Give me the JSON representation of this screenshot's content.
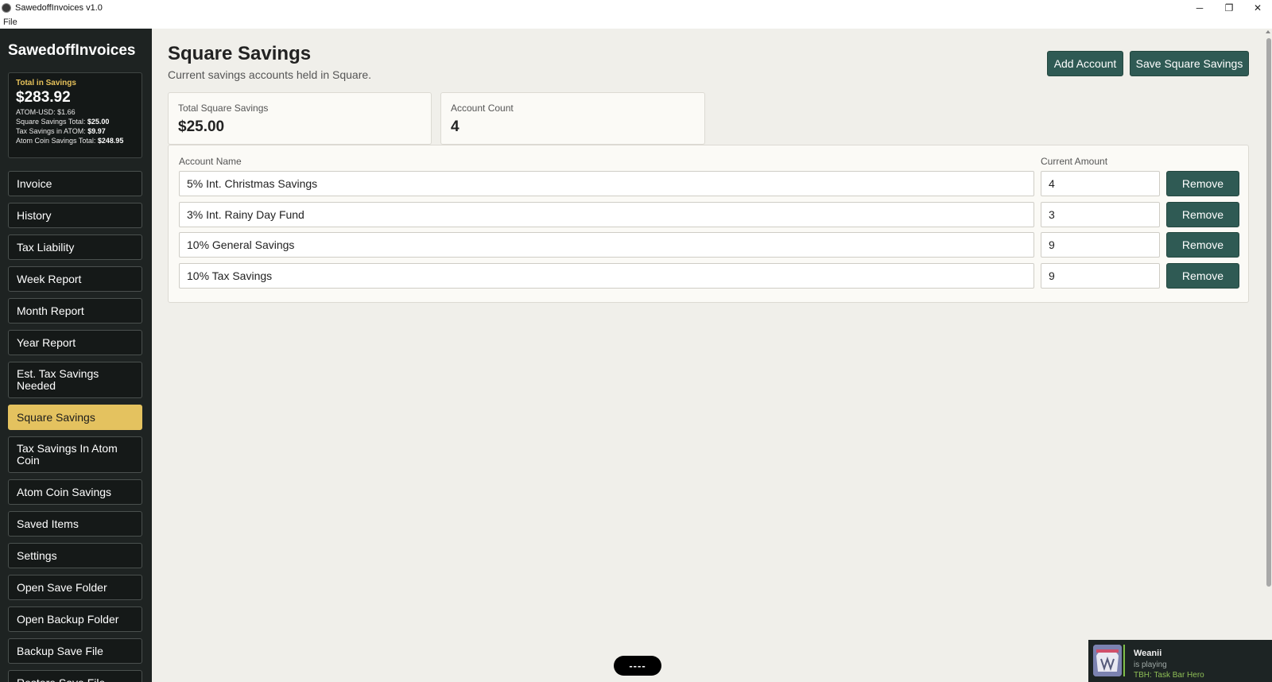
{
  "window": {
    "title": "SawedoffInvoices v1.0",
    "menu": [
      "File"
    ],
    "controls": {
      "minimize": "─",
      "maximize": "❐",
      "close": "✕"
    }
  },
  "sidebar": {
    "brand": "SawedoffInvoices",
    "summary": {
      "label": "Total in Savings",
      "total": "$283.92",
      "atom_price": "ATOM-USD: $1.66",
      "square_label": "Square Savings Total:",
      "square_value": "$25.00",
      "tax_label": "Tax Savings in ATOM:",
      "tax_value": "$9.97",
      "atom_label": "Atom Coin Savings Total:",
      "atom_value": "$248.95"
    },
    "items": [
      {
        "label": "Invoice"
      },
      {
        "label": "History"
      },
      {
        "label": "Tax Liability"
      },
      {
        "label": "Week Report"
      },
      {
        "label": "Month Report"
      },
      {
        "label": "Year Report"
      },
      {
        "label": "Est. Tax Savings Needed"
      },
      {
        "label": "Square Savings"
      },
      {
        "label": "Tax Savings In Atom Coin"
      },
      {
        "label": "Atom Coin Savings"
      },
      {
        "label": "Saved Items"
      },
      {
        "label": "Settings"
      },
      {
        "label": "Open Save Folder"
      },
      {
        "label": "Open Backup Folder"
      },
      {
        "label": "Backup Save File"
      },
      {
        "label": "Restore Save File"
      }
    ],
    "active_index": 7
  },
  "main": {
    "title": "Square Savings",
    "subtitle": "Current savings accounts held in Square.",
    "add_button": "Add Account",
    "save_button": "Save Square Savings",
    "cards": {
      "total_label": "Total Square Savings",
      "total_value": "$25.00",
      "count_label": "Account Count",
      "count_value": "4"
    },
    "table": {
      "col_name": "Account Name",
      "col_amount": "Current Amount",
      "remove_label": "Remove",
      "rows": [
        {
          "name": "5% Int. Christmas Savings",
          "amount": "4"
        },
        {
          "name": "3% Int. Rainy Day Fund",
          "amount": "3"
        },
        {
          "name": "10% General Savings",
          "amount": "9"
        },
        {
          "name": "10% Tax Savings",
          "amount": "9"
        }
      ]
    }
  },
  "pill": {
    "label": "----"
  },
  "toast": {
    "name": "Weanii",
    "status": "is playing",
    "game": "TBH: Task Bar Hero"
  },
  "colors": {
    "sidebar_bg": "#1e2322",
    "accent": "#e4c25f",
    "button": "#2f5a54",
    "page_bg": "#f0efea"
  }
}
